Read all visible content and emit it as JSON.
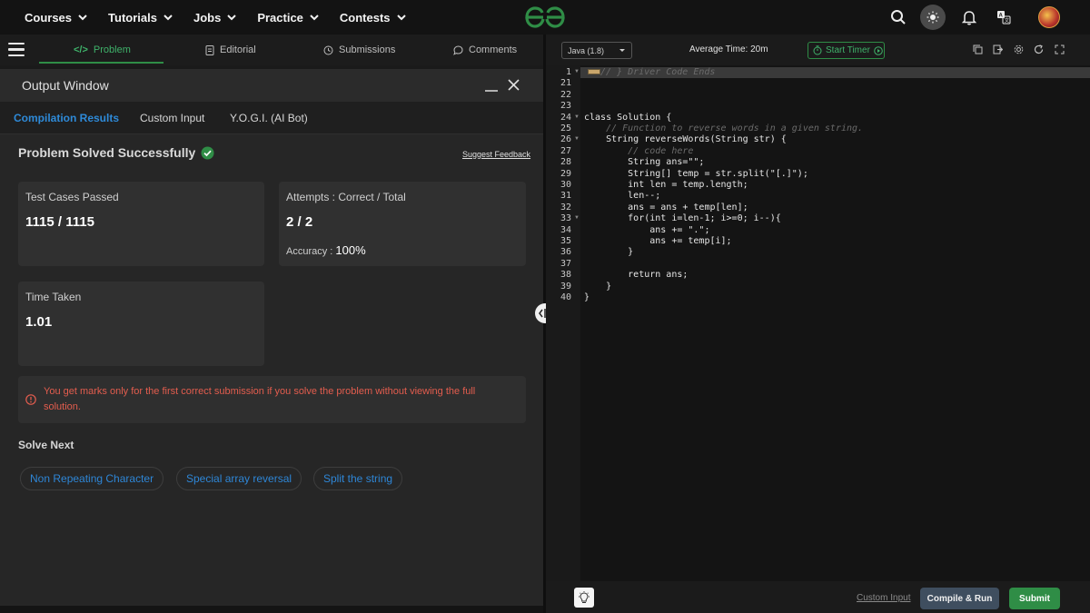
{
  "nav": {
    "items": [
      {
        "label": "Courses"
      },
      {
        "label": "Tutorials"
      },
      {
        "label": "Jobs"
      },
      {
        "label": "Practice"
      },
      {
        "label": "Contests"
      }
    ],
    "icons": [
      "search-icon",
      "theme-toggle-icon",
      "bell-icon",
      "translate-icon",
      "avatar"
    ]
  },
  "problem_tabs": {
    "problem": "Problem",
    "problem_prefix": "</>",
    "editorial": "Editorial",
    "submissions": "Submissions",
    "comments": "Comments"
  },
  "output": {
    "title": "Output Window",
    "tabs": {
      "compilation": "Compilation Results",
      "custom": "Custom Input",
      "yogi": "Y.O.G.I. (AI Bot)"
    },
    "status": "Problem Solved Successfully",
    "feedback_link": "Suggest Feedback",
    "cards": {
      "test_cases_label": "Test Cases Passed",
      "test_cases_value": "1115 / 1115",
      "attempts_label": "Attempts : Correct / Total",
      "attempts_value": "2 / 2",
      "accuracy_label": "Accuracy :",
      "accuracy_value": "100%",
      "time_label": "Time Taken",
      "time_value": "1.01"
    },
    "warning": "You get marks only for the first correct submission if you solve the problem without viewing the full solution.",
    "solve_next_title": "Solve Next",
    "solve_next": [
      "Non Repeating Character",
      "Special array reversal",
      "Split the string"
    ]
  },
  "editor": {
    "language": "Java (1.8)",
    "average_time": "Average Time: 20m",
    "start_timer": "Start Timer",
    "lines": [
      {
        "n": "1",
        "fold": true,
        "text": "// } Driver Code Ends",
        "comment": true,
        "highlight": true,
        "folded": true
      },
      {
        "n": "21",
        "text": ""
      },
      {
        "n": "22",
        "text": ""
      },
      {
        "n": "23",
        "text": ""
      },
      {
        "n": "24",
        "fold": true,
        "text": "class Solution {"
      },
      {
        "n": "25",
        "text": "    // Function to reverse words in a given string.",
        "comment": true
      },
      {
        "n": "26",
        "fold": true,
        "text": "    String reverseWords(String str) {"
      },
      {
        "n": "27",
        "text": "        // code here",
        "comment": true
      },
      {
        "n": "28",
        "text": "        String ans=\"\";"
      },
      {
        "n": "29",
        "text": "        String[] temp = str.split(\"[.]\");"
      },
      {
        "n": "30",
        "text": "        int len = temp.length;"
      },
      {
        "n": "31",
        "text": "        len--;"
      },
      {
        "n": "32",
        "text": "        ans = ans + temp[len];"
      },
      {
        "n": "33",
        "fold": true,
        "text": "        for(int i=len-1; i>=0; i--){"
      },
      {
        "n": "34",
        "text": "            ans += \".\";"
      },
      {
        "n": "35",
        "text": "            ans += temp[i];"
      },
      {
        "n": "36",
        "text": "        }"
      },
      {
        "n": "37",
        "text": ""
      },
      {
        "n": "38",
        "text": "        return ans;"
      },
      {
        "n": "39",
        "text": "    }"
      },
      {
        "n": "40",
        "text": "}"
      }
    ],
    "footer": {
      "custom_input": "Custom Input",
      "compile_run": "Compile & Run",
      "submit": "Submit"
    }
  },
  "colors": {
    "accent_green": "#2f8d46",
    "link_blue": "#2e86d6",
    "warning_red": "#e35d4e",
    "compile_button": "#3f4e5f"
  }
}
